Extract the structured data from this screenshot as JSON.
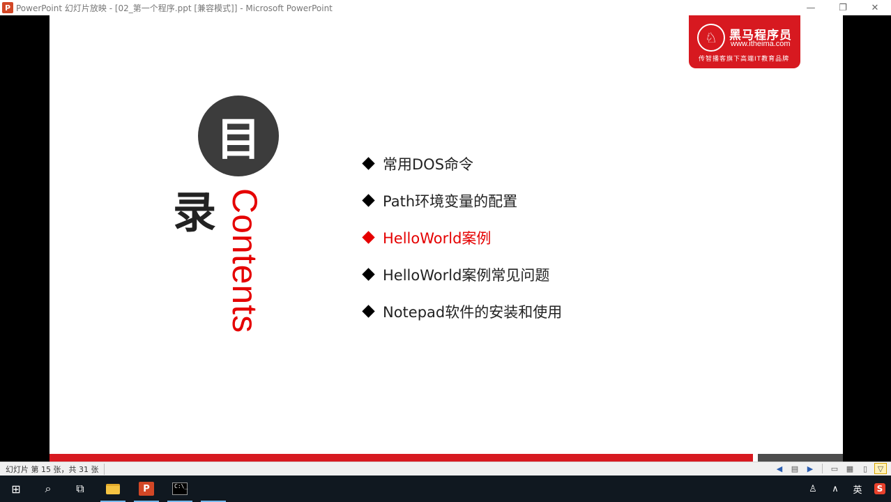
{
  "window": {
    "app_icon_letter": "P",
    "title": "PowerPoint 幻灯片放映 - [02_第一个程序.ppt [兼容模式]] - Microsoft PowerPoint",
    "minimize_glyph": "—",
    "restore_glyph": "❐",
    "close_glyph": "✕"
  },
  "slide": {
    "logo": {
      "icon_glyph": "♘",
      "name": "黑马程序员",
      "url": "www.itheima.com",
      "slogan": "传智播客旗下高端IT教育品牌"
    },
    "toc_char_1": "目",
    "toc_char_2": "录",
    "contents_word": "Contents",
    "menu": [
      {
        "label": "常用DOS命令",
        "active": false
      },
      {
        "label": "Path环境变量的配置",
        "active": false
      },
      {
        "label": "HelloWorld案例",
        "active": true
      },
      {
        "label": "HelloWorld案例常见问题",
        "active": false
      },
      {
        "label": "Notepad软件的安装和使用",
        "active": false
      }
    ],
    "colors": {
      "accent": "#e50000",
      "brand_red": "#d71920",
      "circle": "#3c3c3c"
    }
  },
  "statusbar": {
    "slide_info": "幻灯片 第 15 张，共 31 张",
    "icons": [
      "prev-icon",
      "menu-icon",
      "next-icon",
      "normal-view-icon",
      "slide-sorter-icon",
      "reading-view-icon",
      "slideshow-icon"
    ]
  },
  "taskbar": {
    "windows_glyph": "⊞",
    "search_glyph": "⌕",
    "taskview_glyph": "⧉",
    "ppt_letter": "P",
    "cmd_text": "C:\\_",
    "tray": {
      "people_glyph": "♙",
      "chevron_glyph": "∧",
      "ime_label": "英",
      "sogou_letter": "S"
    }
  }
}
